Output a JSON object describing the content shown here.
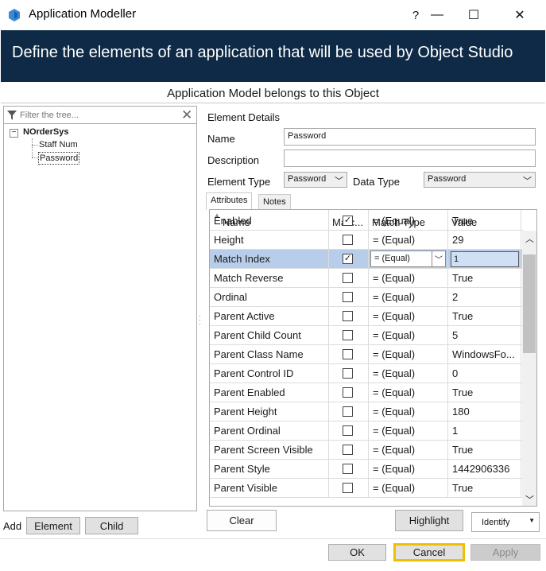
{
  "window": {
    "title": "Application Modeller",
    "help": "?",
    "minimize": "—",
    "maximize": "☐",
    "close": "✕"
  },
  "banner": {
    "text": "Define the elements of an application that will be used by Object Studio"
  },
  "subbanner": {
    "text": "Application Model belongs to this Object"
  },
  "tree": {
    "filter_placeholder": "Filter the tree...",
    "root": "NOrderSys",
    "children": [
      "Staff Num",
      "Password"
    ],
    "selected": "Password"
  },
  "left_buttons": {
    "add_label": "Add",
    "element": "Element",
    "child": "Child"
  },
  "details": {
    "heading": "Element Details",
    "name_label": "Name",
    "name_value": "Password",
    "description_label": "Description",
    "description_value": "",
    "element_type_label": "Element Type",
    "element_type_value": "Password",
    "data_type_label": "Data Type",
    "data_type_value": "Password"
  },
  "tabs": [
    "Attributes",
    "Notes"
  ],
  "grid": {
    "headers": [
      "Name",
      "Matc...",
      "Match Type",
      "Value"
    ],
    "rows": [
      {
        "name": "Enabled",
        "match": true,
        "type": "=  (Equal)",
        "value": "True"
      },
      {
        "name": "Height",
        "match": false,
        "type": "=  (Equal)",
        "value": "29"
      },
      {
        "name": "Match Index",
        "match": true,
        "type": "=  (Equal)",
        "value": "1"
      },
      {
        "name": "Match Reverse",
        "match": false,
        "type": "=  (Equal)",
        "value": "True"
      },
      {
        "name": "Ordinal",
        "match": false,
        "type": "=  (Equal)",
        "value": "2"
      },
      {
        "name": "Parent Active",
        "match": false,
        "type": "=  (Equal)",
        "value": "True"
      },
      {
        "name": "Parent Child Count",
        "match": false,
        "type": "=  (Equal)",
        "value": "5"
      },
      {
        "name": "Parent Class Name",
        "match": false,
        "type": "=  (Equal)",
        "value": "WindowsFo..."
      },
      {
        "name": "Parent Control ID",
        "match": false,
        "type": "=  (Equal)",
        "value": "0"
      },
      {
        "name": "Parent Enabled",
        "match": false,
        "type": "=  (Equal)",
        "value": "True"
      },
      {
        "name": "Parent Height",
        "match": false,
        "type": "=  (Equal)",
        "value": "180"
      },
      {
        "name": "Parent Ordinal",
        "match": false,
        "type": "=  (Equal)",
        "value": "1"
      },
      {
        "name": "Parent Screen Visible",
        "match": false,
        "type": "=  (Equal)",
        "value": "True"
      },
      {
        "name": "Parent Style",
        "match": false,
        "type": "=  (Equal)",
        "value": "1442906336"
      },
      {
        "name": "Parent Visible",
        "match": false,
        "type": "=  (Equal)",
        "value": "True"
      }
    ],
    "selected_index": 2
  },
  "buttons": {
    "clear": "Clear",
    "highlight": "Highlight",
    "identify": "Identify",
    "ok": "OK",
    "cancel": "Cancel",
    "apply": "Apply"
  },
  "colors": {
    "banner": "#0e2a46",
    "selection": "#b7cde9",
    "focus_border": "#f0c000"
  }
}
